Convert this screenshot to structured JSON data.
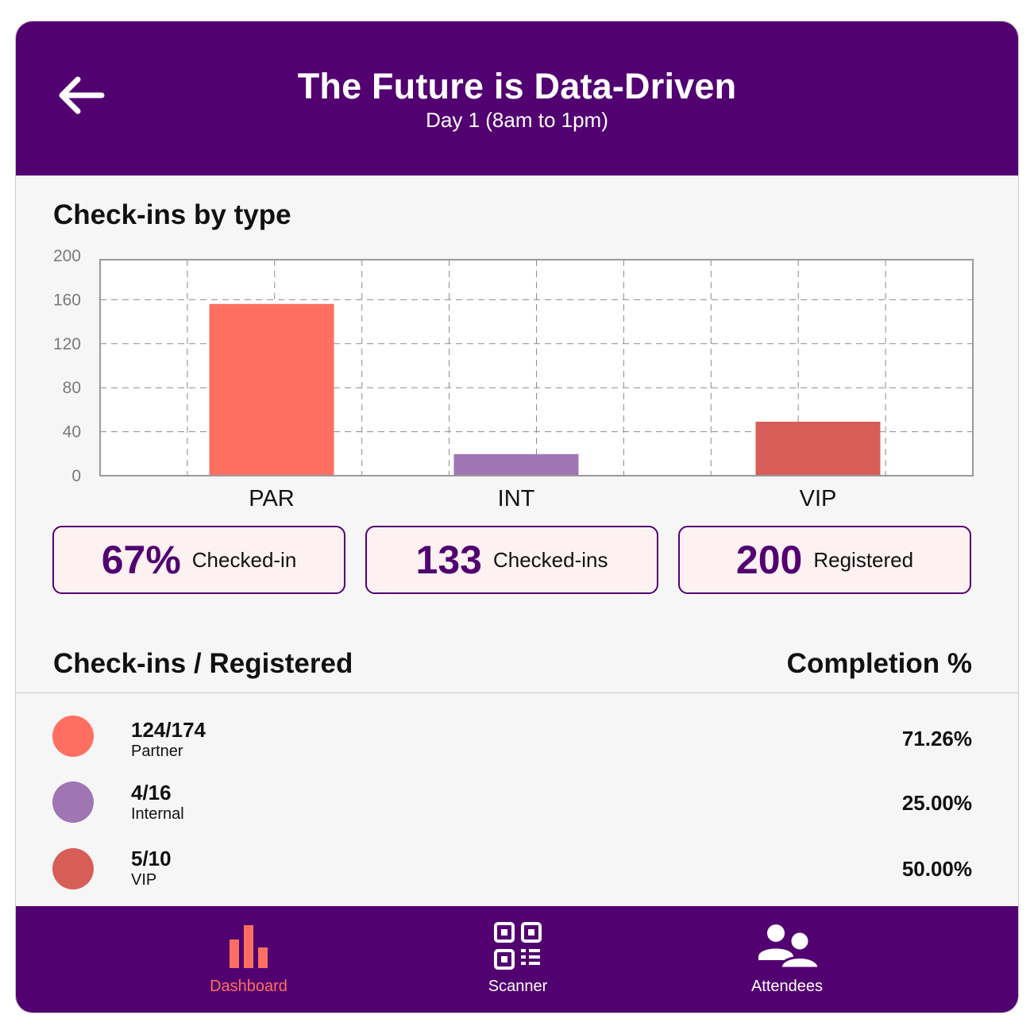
{
  "header": {
    "title": "The Future is Data-Driven",
    "subtitle": "Day 1 (8am to 1pm)",
    "back_icon": "arrow-left-icon",
    "background": "#520270"
  },
  "checkins_section": {
    "title": "Check-ins by type"
  },
  "chart_data": {
    "type": "bar",
    "categories": [
      "PAR",
      "INT",
      "VIP"
    ],
    "values": [
      159,
      20,
      50
    ],
    "colors": [
      "#ff6f61",
      "#a075b4",
      "#d75e57"
    ],
    "yticks": [
      "0",
      "40",
      "80",
      "120",
      "160",
      "200"
    ],
    "ylim": [
      0,
      200
    ],
    "grid": true,
    "title": "",
    "xlabel": "",
    "ylabel": ""
  },
  "stats": [
    {
      "value": "67%",
      "label": "Checked-in"
    },
    {
      "value": "133",
      "label": "Checked-ins"
    },
    {
      "value": "200",
      "label": "Registered"
    }
  ],
  "table": {
    "left_header": "Check-ins / Registered",
    "right_header": "Completion %",
    "rows": [
      {
        "count": "124/174",
        "name": "Partner",
        "percent": "71.26%",
        "color": "#ff6f61"
      },
      {
        "count": "4/16",
        "name": "Internal",
        "percent": "25.00%",
        "color": "#a075b4"
      },
      {
        "count": "5/10",
        "name": "VIP",
        "percent": "50.00%",
        "color": "#d75e57"
      }
    ]
  },
  "nav": {
    "items": [
      {
        "label": "Dashboard",
        "icon": "bar-chart-icon",
        "active": true
      },
      {
        "label": "Scanner",
        "icon": "qr-code-icon",
        "active": false
      },
      {
        "label": "Attendees",
        "icon": "people-icon",
        "active": false
      }
    ],
    "active_color": "#ff6f61"
  }
}
